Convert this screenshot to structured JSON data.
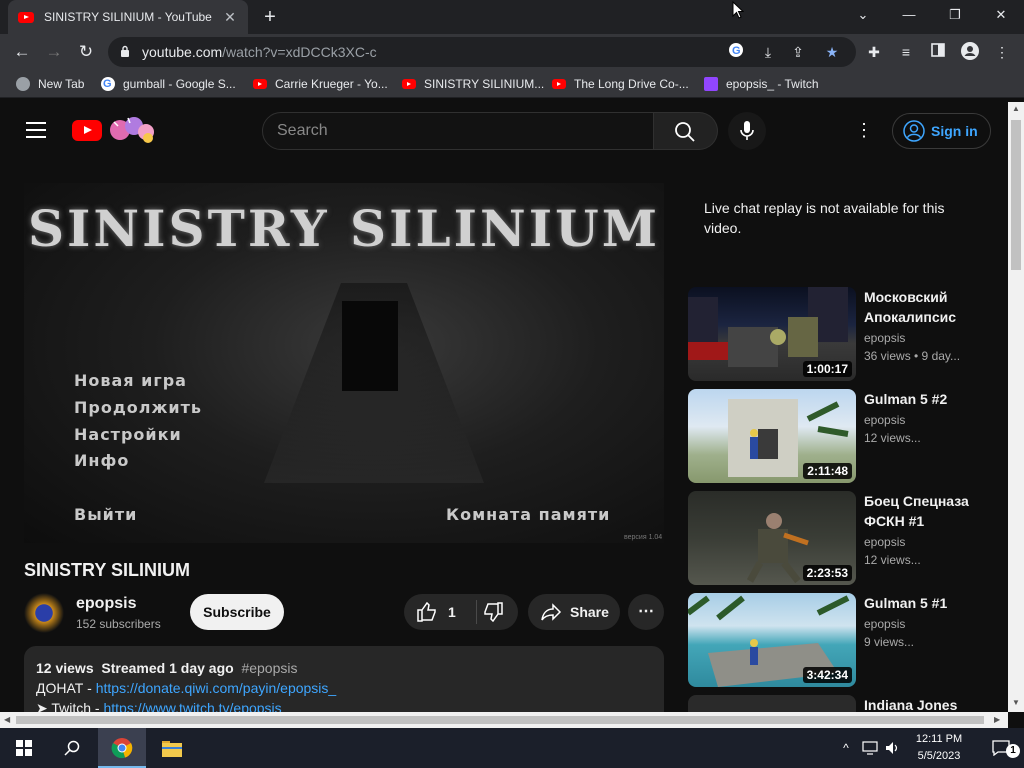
{
  "browser": {
    "tab_title": "SINISTRY SILINIUM - YouTube",
    "url_host": "youtube.com",
    "url_path": "/watch?v=xdDCCk3XC-c",
    "bookmarks": [
      {
        "label": "New Tab",
        "icon": "globe-icon"
      },
      {
        "label": "gumball - Google S...",
        "icon": "google-icon"
      },
      {
        "label": "Carrie Krueger - Yo...",
        "icon": "youtube-icon"
      },
      {
        "label": "SINISTRY SILINIUM...",
        "icon": "youtube-icon"
      },
      {
        "label": "The Long Drive Co-...",
        "icon": "youtube-icon"
      },
      {
        "label": "epopsis_ - Twitch",
        "icon": "twitch-icon"
      }
    ]
  },
  "youtube": {
    "search_placeholder": "Search",
    "sign_in": "Sign in",
    "video": {
      "game_title": "SINISTRY SILINIUM",
      "menu": [
        "Новая игра",
        "Продолжить",
        "Настройки",
        "Инфо",
        "Выйти"
      ],
      "memory_room": "Комната памяти",
      "version": "версия 1.04",
      "title": "SINISTRY SILINIUM"
    },
    "channel": {
      "name": "epopsis",
      "subscribers": "152 subscribers",
      "subscribe": "Subscribe"
    },
    "actions": {
      "likes": "1",
      "share": "Share"
    },
    "description": {
      "views": "12 views",
      "streamed": "Streamed 1 day ago",
      "hashtag": "#epopsis",
      "line1_label": "ДОНАТ - ",
      "line1_link": "https://donate.qiwi.com/payin/epopsis_",
      "line2_label": "➤ Twitch - ",
      "line2_link": "https://www.twitch.tv/epopsis"
    },
    "chat_notice": "Live chat replay is not available for this video.",
    "recommendations": [
      {
        "title": "Московский Апокалипсис",
        "channel": "epopsis",
        "views": "36 views • 9 day...",
        "duration": "1:00:17"
      },
      {
        "title": "Gulman 5 #2",
        "channel": "epopsis",
        "views": "12 views...",
        "duration": "2:11:48"
      },
      {
        "title": "Боец Спецназа ФСКН #1",
        "channel": "epopsis",
        "views": "12 views...",
        "duration": "2:23:53"
      },
      {
        "title": "Gulman 5 #1",
        "channel": "epopsis",
        "views": "9 views...",
        "duration": "3:42:34"
      },
      {
        "title": "Indiana Jones",
        "channel": "",
        "views": "",
        "duration": ""
      }
    ]
  },
  "taskbar": {
    "time": "12:11 PM",
    "date": "5/5/2023",
    "notifications": "1"
  }
}
